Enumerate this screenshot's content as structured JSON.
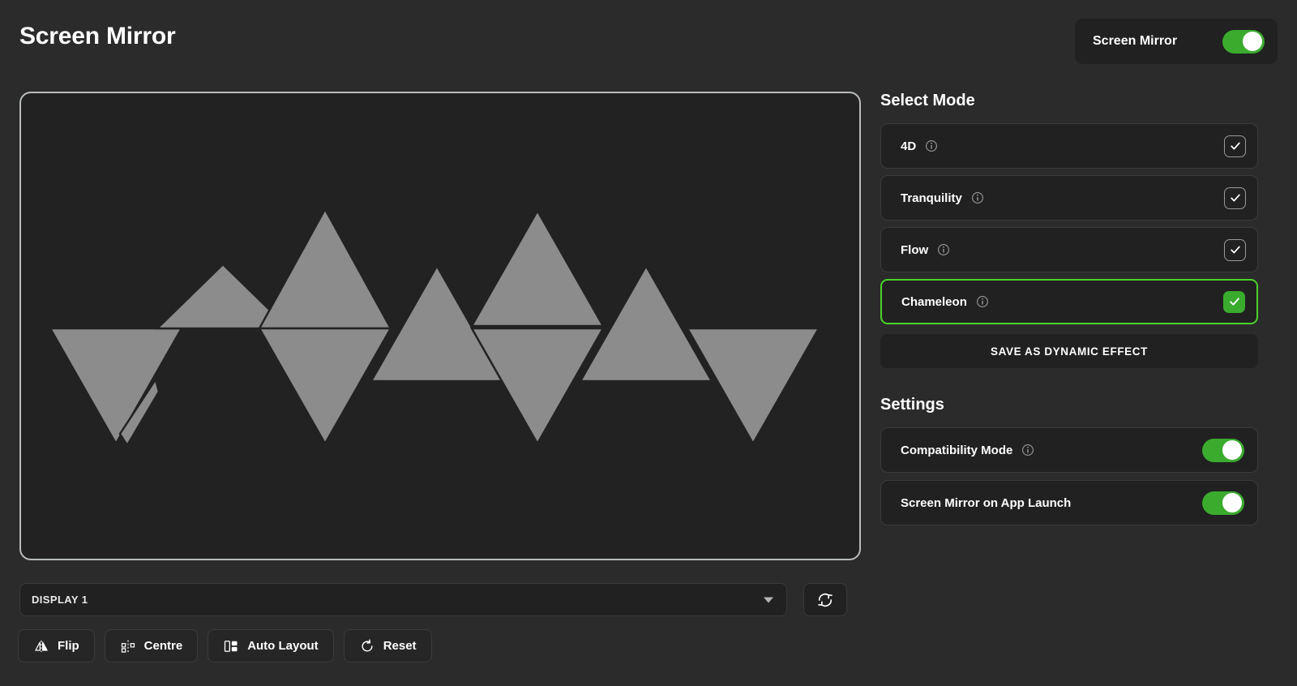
{
  "header": {
    "title": "Screen Mirror",
    "toggle_label": "Screen Mirror",
    "toggle_on": true,
    "accent_green": "#3bab2e"
  },
  "canvas": {
    "background": "#222222",
    "border_color": "#b9bcbd",
    "panel_fill": "#8c8c8c",
    "panel_count": 11
  },
  "display_select": {
    "value": "DISPLAY 1",
    "caret_icon": "chevron-down-icon"
  },
  "refresh": {
    "icon": "refresh-icon"
  },
  "toolbar": {
    "buttons": [
      {
        "label": "Flip",
        "icon": "flip-icon"
      },
      {
        "label": "Centre",
        "icon": "centre-icon"
      },
      {
        "label": "Auto Layout",
        "icon": "auto-layout-icon"
      },
      {
        "label": "Reset",
        "icon": "reset-icon"
      }
    ]
  },
  "select_mode": {
    "heading": "Select Mode",
    "items": [
      {
        "label": "4D",
        "info_icon": "info-icon",
        "selected": false
      },
      {
        "label": "Tranquility",
        "info_icon": "info-icon",
        "selected": false
      },
      {
        "label": "Flow",
        "info_icon": "info-icon",
        "selected": false
      },
      {
        "label": "Chameleon",
        "info_icon": "info-icon",
        "selected": true
      }
    ],
    "save_label": "SAVE AS DYNAMIC EFFECT",
    "selected_border": "#4ad22b"
  },
  "settings": {
    "heading": "Settings",
    "items": [
      {
        "label": "Compatibility Mode",
        "has_info": true,
        "toggle_on": true
      },
      {
        "label": "Screen Mirror on App Launch",
        "has_info": false,
        "toggle_on": true
      }
    ]
  }
}
